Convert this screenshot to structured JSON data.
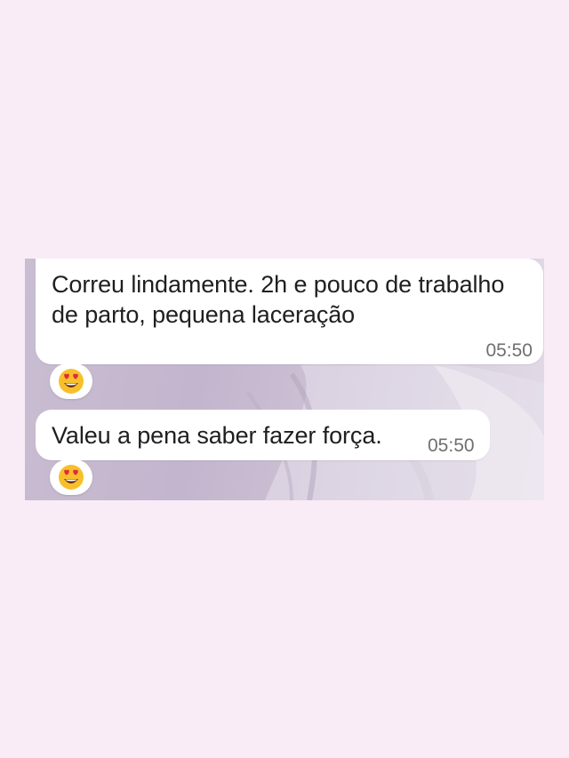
{
  "messages": [
    {
      "text": "Correu lindamente. 2h e pouco de trabalho de parto, pequena laceração",
      "time": "05:50",
      "reaction": "heart-eyes-emoji"
    },
    {
      "text": "Valeu a pena saber fazer força.",
      "time": "05:50",
      "reaction": "heart-eyes-emoji"
    }
  ],
  "colors": {
    "page_background": "#f9ecf7",
    "bubble": "#ffffff",
    "wallpaper": "#c9bdd2",
    "time_text": "#6f6f6f"
  }
}
